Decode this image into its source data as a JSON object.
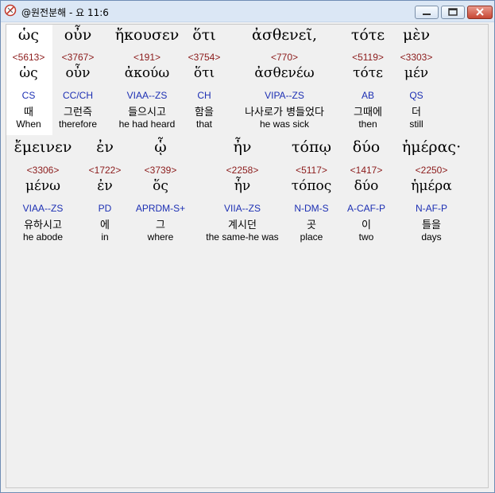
{
  "window": {
    "title": "@원전분해 - 요 11:6"
  },
  "icons": {
    "app": "app-icon",
    "minimize": "minimize-icon",
    "maximize": "maximize-icon",
    "close": "close-icon"
  },
  "rows": [
    [
      {
        "greek": "ὡς",
        "number": "<5613>",
        "lemma": "ὡς",
        "parsing": "CS",
        "korean": "때",
        "english": "When"
      },
      {
        "greek": "οὖν",
        "number": "<3767>",
        "lemma": "οὖν",
        "parsing": "CC/CH",
        "korean": "그런즉",
        "english": "therefore"
      },
      {
        "greek": "ἤκουσεν",
        "number": "<191>",
        "lemma": "ἀκούω",
        "parsing": "VIAA--ZS",
        "korean": "들으시고",
        "english": "he had heard"
      },
      {
        "greek": "ὅτι",
        "number": "<3754>",
        "lemma": "ὅτι",
        "parsing": "CH",
        "korean": "함을",
        "english": "that"
      },
      {
        "greek": "ἀσθενεῖ,",
        "number": "<770>",
        "lemma": "ἀσθενέω",
        "parsing": "VIPA--ZS",
        "korean": "나사로가 병들었다",
        "english": "he was sick"
      },
      {
        "greek": "τότε",
        "number": "<5119>",
        "lemma": "τότε",
        "parsing": "AB",
        "korean": "그때에",
        "english": "then"
      },
      {
        "greek": "μὲν",
        "number": "<3303>",
        "lemma": "μέν",
        "parsing": "QS",
        "korean": "더",
        "english": "still"
      }
    ],
    [
      {
        "greek": "ἔμεινεν",
        "number": "<3306>",
        "lemma": "μένω",
        "parsing": "VIAA--ZS",
        "korean": "유하시고",
        "english": "he abode"
      },
      {
        "greek": "ἐν",
        "number": "<1722>",
        "lemma": "ἐν",
        "parsing": "PD",
        "korean": "에",
        "english": "in"
      },
      {
        "greek": "ᾧ",
        "number": "<3739>",
        "lemma": "ὅς",
        "parsing": "APRDM-S+",
        "korean": "그",
        "english": "where"
      },
      {
        "greek": "ἦν",
        "number": "<2258>",
        "lemma": "ἦν",
        "parsing": "VIIA--ZS",
        "korean": "계시던",
        "english": "the same-he was"
      },
      {
        "greek": "τόπῳ",
        "number": "<5117>",
        "lemma": "τόπος",
        "parsing": "N-DM-S",
        "korean": "곳",
        "english": "place"
      },
      {
        "greek": "δύο",
        "number": "<1417>",
        "lemma": "δύο",
        "parsing": "A-CAF-P",
        "korean": "이",
        "english": "two"
      },
      {
        "greek": "ἡμέρας·",
        "number": "<2250>",
        "lemma": "ἡμέρα",
        "parsing": "N-AF-P",
        "korean": "틀을",
        "english": "days"
      }
    ]
  ]
}
